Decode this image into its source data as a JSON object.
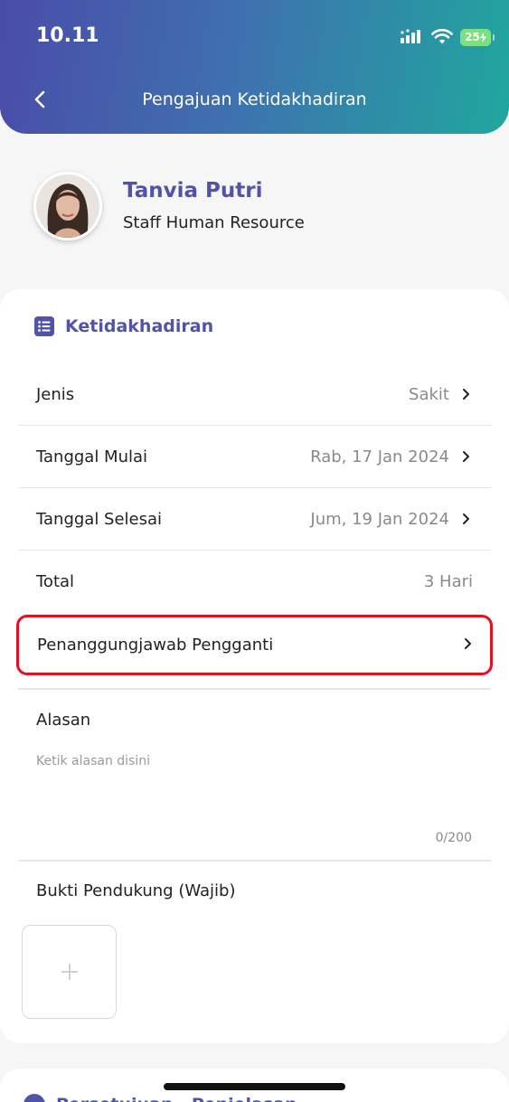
{
  "status_bar": {
    "time": "10.11",
    "battery": "25"
  },
  "header": {
    "title": "Pengajuan Ketidakhadiran"
  },
  "profile": {
    "name": "Tanvia Putri",
    "role": "Staff Human Resource"
  },
  "section": {
    "title": "Ketidakhadiran"
  },
  "fields": {
    "jenis": {
      "label": "Jenis",
      "value": "Sakit"
    },
    "tanggal_mulai": {
      "label": "Tanggal Mulai",
      "value": "Rab, 17 Jan 2024"
    },
    "tanggal_selesai": {
      "label": "Tanggal Selesai",
      "value": "Jum, 19 Jan 2024"
    },
    "total": {
      "label": "Total",
      "value": "3 Hari"
    },
    "pengganti": {
      "label": "Penanggungjawab Pengganti"
    }
  },
  "alasan": {
    "label": "Alasan",
    "placeholder": "Ketik alasan disini",
    "counter": "0/200"
  },
  "bukti": {
    "label": "Bukti Pendukung (Wajib)"
  },
  "next_section": {
    "title": "Persetujuan · Penjelasan"
  },
  "colors": {
    "accent": "#5153a6",
    "highlight": "#e3101f",
    "gradient_start": "#4a4ca8",
    "gradient_end": "#20a79e"
  },
  "icons": [
    "chevron-left-icon",
    "signal-icon",
    "wifi-icon",
    "battery-icon",
    "list-icon",
    "chevron-right-icon",
    "plus-icon"
  ]
}
